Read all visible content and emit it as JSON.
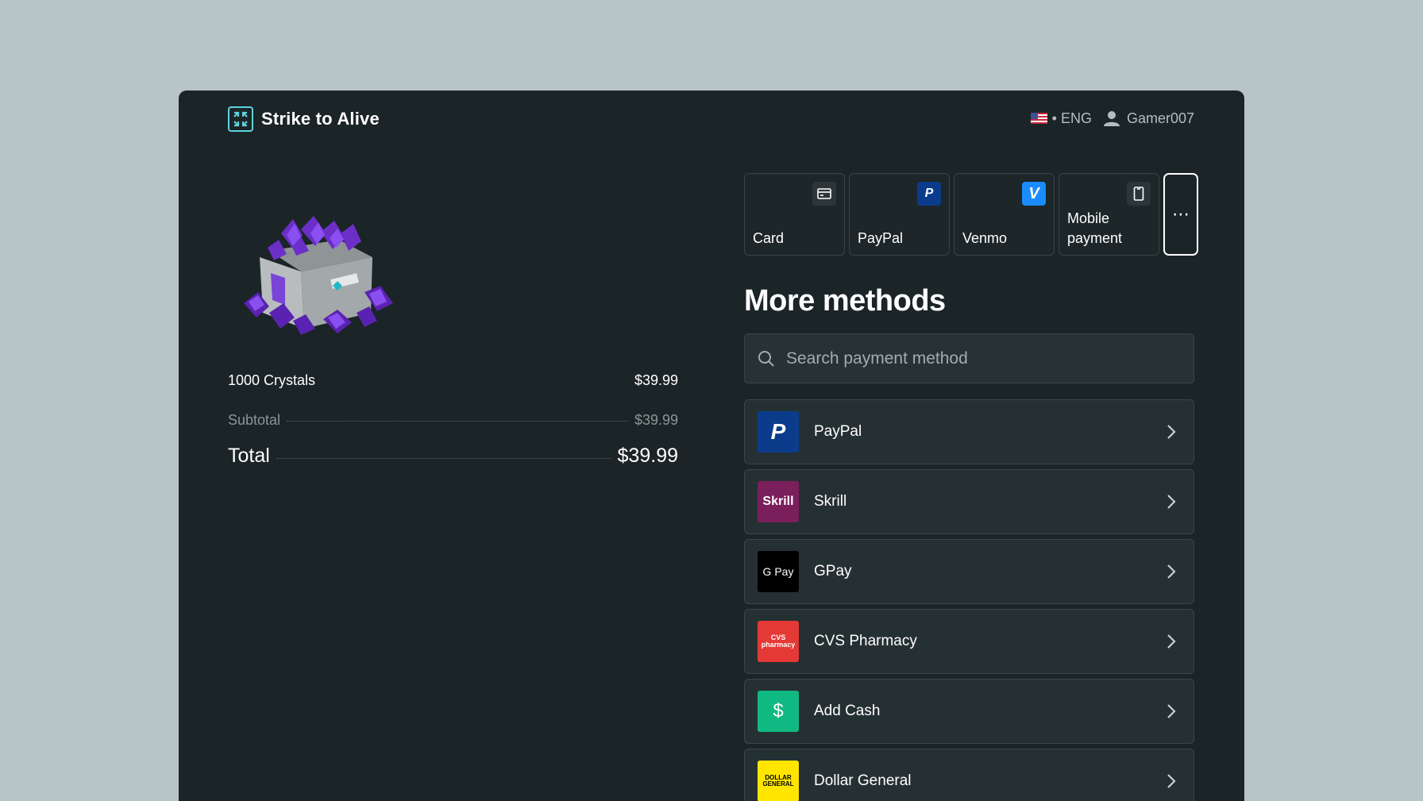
{
  "app": {
    "name": "Strike to Alive"
  },
  "header": {
    "language": "• ENG",
    "username": "Gamer007"
  },
  "order": {
    "item_name": "1000 Crystals",
    "item_price": "$39.99",
    "subtotal_label": "Subtotal",
    "subtotal_value": "$39.99",
    "total_label": "Total",
    "total_value": "$39.99"
  },
  "tabs": [
    {
      "label": "Card",
      "icon": "card-icon"
    },
    {
      "label": "PayPal",
      "icon": "paypal-icon"
    },
    {
      "label": "Venmo",
      "icon": "venmo-icon"
    },
    {
      "label": "Mobile payment",
      "icon": "mobile-icon"
    }
  ],
  "more": {
    "title": "More methods",
    "search_placeholder": "Search payment method"
  },
  "methods": [
    {
      "label": "PayPal",
      "logo_text": "P",
      "logo_bg": "#0b3c8c"
    },
    {
      "label": "Skrill",
      "logo_text": "Skrill",
      "logo_bg": "#7b1f5c"
    },
    {
      "label": "GPay",
      "logo_text": "G Pay",
      "logo_bg": "#000000"
    },
    {
      "label": "CVS Pharmacy",
      "logo_text": "CVS pharmacy",
      "logo_bg": "#e53935"
    },
    {
      "label": "Add Cash",
      "logo_text": "$",
      "logo_bg": "#10b981"
    },
    {
      "label": "Dollar General",
      "logo_text": "DOLLAR GENERAL",
      "logo_bg": "#ffe500"
    }
  ],
  "colors": {
    "accent": "#5fd3e0",
    "panel": "#1b2426",
    "card": "#253033",
    "venmo": "#1a8cff"
  }
}
